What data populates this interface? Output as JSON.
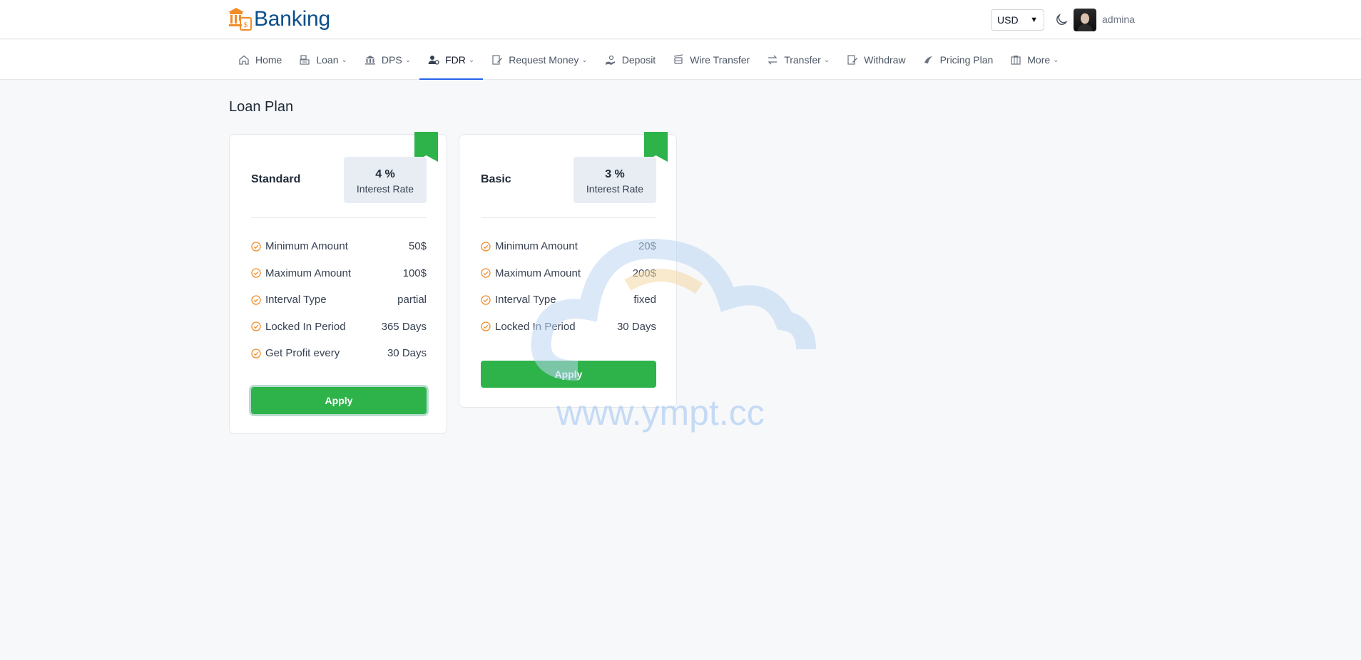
{
  "brand": {
    "name": "Banking"
  },
  "header": {
    "currency": "USD",
    "username": "admina"
  },
  "nav": {
    "items": [
      {
        "label": "Home",
        "icon": "home-icon",
        "dropdown": false
      },
      {
        "label": "Loan",
        "icon": "loan-icon",
        "dropdown": true
      },
      {
        "label": "DPS",
        "icon": "bank-icon",
        "dropdown": true
      },
      {
        "label": "FDR",
        "icon": "user-lock-icon",
        "dropdown": true,
        "active": true
      },
      {
        "label": "Request Money",
        "icon": "money-request-icon",
        "dropdown": true
      },
      {
        "label": "Deposit",
        "icon": "deposit-icon",
        "dropdown": false
      },
      {
        "label": "Wire Transfer",
        "icon": "wire-icon",
        "dropdown": false
      },
      {
        "label": "Transfer",
        "icon": "swap-icon",
        "dropdown": true
      },
      {
        "label": "Withdraw",
        "icon": "withdraw-icon",
        "dropdown": false
      },
      {
        "label": "Pricing Plan",
        "icon": "pricing-icon",
        "dropdown": false
      },
      {
        "label": "More",
        "icon": "more-icon",
        "dropdown": true
      }
    ]
  },
  "page": {
    "title": "Loan Plan"
  },
  "plans": [
    {
      "name": "Standard",
      "rate": "4 %",
      "rate_label": "Interest Rate",
      "features": [
        {
          "label": "Minimum Amount",
          "value": "50$"
        },
        {
          "label": "Maximum Amount",
          "value": "100$"
        },
        {
          "label": "Interval Type",
          "value": "partial"
        },
        {
          "label": "Locked In Period",
          "value": "365 Days"
        },
        {
          "label": "Get Profit every",
          "value": "30 Days"
        }
      ],
      "apply_label": "Apply"
    },
    {
      "name": "Basic",
      "rate": "3 %",
      "rate_label": "Interest Rate",
      "features": [
        {
          "label": "Minimum Amount",
          "value": "20$"
        },
        {
          "label": "Maximum Amount",
          "value": "200$"
        },
        {
          "label": "Interval Type",
          "value": "fixed"
        },
        {
          "label": "Locked In Period",
          "value": "30 Days"
        }
      ],
      "apply_label": "Apply"
    }
  ],
  "watermark": {
    "text": "www.ympt.cc"
  },
  "colors": {
    "brand": "#0b4f8a",
    "accent": "#2db34a",
    "check": "#f28c28",
    "active_nav": "#2563eb"
  }
}
